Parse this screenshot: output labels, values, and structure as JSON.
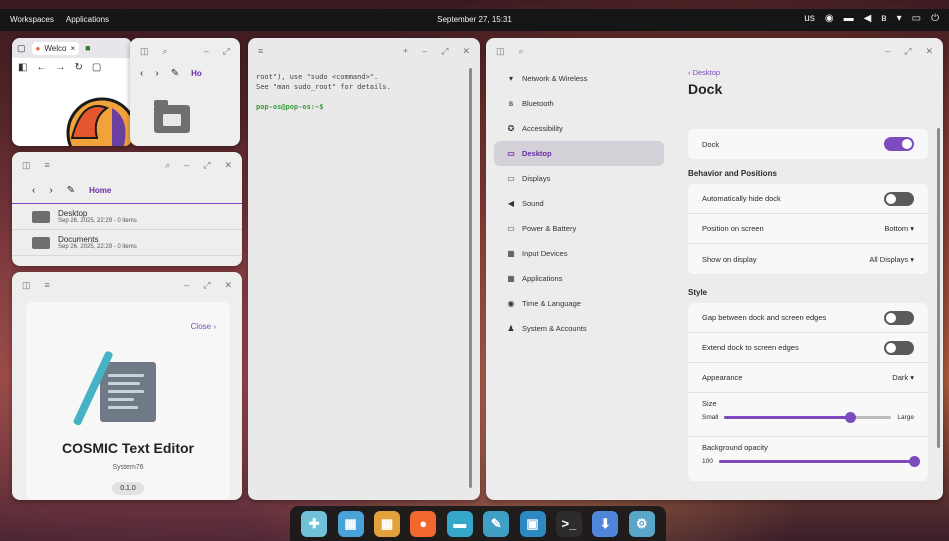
{
  "topbar": {
    "workspaces": "Workspaces",
    "applications": "Applications",
    "clock": "September 27, 15:31",
    "tray_lang": "us",
    "tray_icons": [
      "tweaks-icon",
      "keyboard-icon",
      "volume-icon",
      "bluetooth-icon",
      "wifi-icon",
      "battery-icon",
      "power-icon"
    ]
  },
  "firefox": {
    "tab_label": "Welco",
    "tab_close": "×"
  },
  "file_manager_small": {
    "location": "Ho"
  },
  "file_manager": {
    "location": "Home",
    "items": [
      {
        "name": "Desktop",
        "meta": "Sep 26, 2025, 22:29 - 0 items"
      },
      {
        "name": "Documents",
        "meta": "Sep 26, 2025, 22:29 - 0 items"
      }
    ]
  },
  "app_info": {
    "close_label": "Close",
    "app_name": "COSMIC Text Editor",
    "developer": "System76",
    "version": "0.1.0"
  },
  "terminal": {
    "line1": "root\"), use \"sudo <command>\".",
    "line2": "See \"man sudo_root\" for details.",
    "prompt": "pop-os@pop-os:~$"
  },
  "settings": {
    "sidebar": [
      {
        "icon": "wifi-icon",
        "glyph": "▾",
        "label": "Network & Wireless"
      },
      {
        "icon": "bluetooth-icon",
        "glyph": "ʙ",
        "label": "Bluetooth"
      },
      {
        "icon": "accessibility-icon",
        "glyph": "✪",
        "label": "Accessibility"
      },
      {
        "icon": "desktop-icon",
        "glyph": "▭",
        "label": "Desktop"
      },
      {
        "icon": "displays-icon",
        "glyph": "▭",
        "label": "Displays"
      },
      {
        "icon": "sound-icon",
        "glyph": "◀",
        "label": "Sound"
      },
      {
        "icon": "battery-icon",
        "glyph": "▭",
        "label": "Power & Battery"
      },
      {
        "icon": "keyboard-icon",
        "glyph": "▦",
        "label": "Input Devices"
      },
      {
        "icon": "apps-icon",
        "glyph": "▦",
        "label": "Applications"
      },
      {
        "icon": "globe-icon",
        "glyph": "◉",
        "label": "Time & Language"
      },
      {
        "icon": "users-icon",
        "glyph": "♟",
        "label": "System & Accounts"
      }
    ],
    "active_index": 3,
    "back_label": "Desktop",
    "title": "Dock",
    "dock_label": "Dock",
    "dock_on": true,
    "behavior_heading": "Behavior and Positions",
    "auto_hide_label": "Automatically hide dock",
    "auto_hide_on": false,
    "position_label": "Position on screen",
    "position_value": "Bottom",
    "show_on_label": "Show on display",
    "show_on_value": "All Displays",
    "style_heading": "Style",
    "gap_label": "Gap between dock and screen edges",
    "gap_on": false,
    "extend_label": "Extend dock to screen edges",
    "extend_on": false,
    "appearance_label": "Appearance",
    "appearance_value": "Dark",
    "size_label": "Size",
    "size_min": "Small",
    "size_max": "Large",
    "size_value": 0.75,
    "opacity_label": "Background opacity",
    "opacity_value_text": "100",
    "opacity_value": 1.0
  },
  "dock_apps": [
    {
      "icon": "launcher-icon",
      "glyph": "✚",
      "color": "#6ec1d6"
    },
    {
      "icon": "workspaces-icon",
      "glyph": "▦",
      "color": "#4aa3d8"
    },
    {
      "icon": "app-library-icon",
      "glyph": "▦",
      "color": "#e3a13b"
    },
    {
      "icon": "firefox-icon",
      "glyph": "●",
      "color": "#f0682e"
    },
    {
      "icon": "files-icon",
      "glyph": "▬",
      "color": "#35a7c9"
    },
    {
      "icon": "text-editor-icon",
      "glyph": "✎",
      "color": "#3f9fc4"
    },
    {
      "icon": "store-icon",
      "glyph": "▣",
      "color": "#2e89c2"
    },
    {
      "icon": "terminal-icon",
      "glyph": ">_",
      "color": "#2c2c2c"
    },
    {
      "icon": "cosmic-store-icon",
      "glyph": "⬇",
      "color": "#4f86d9"
    },
    {
      "icon": "settings-icon",
      "glyph": "⚙",
      "color": "#59a6c9"
    }
  ]
}
